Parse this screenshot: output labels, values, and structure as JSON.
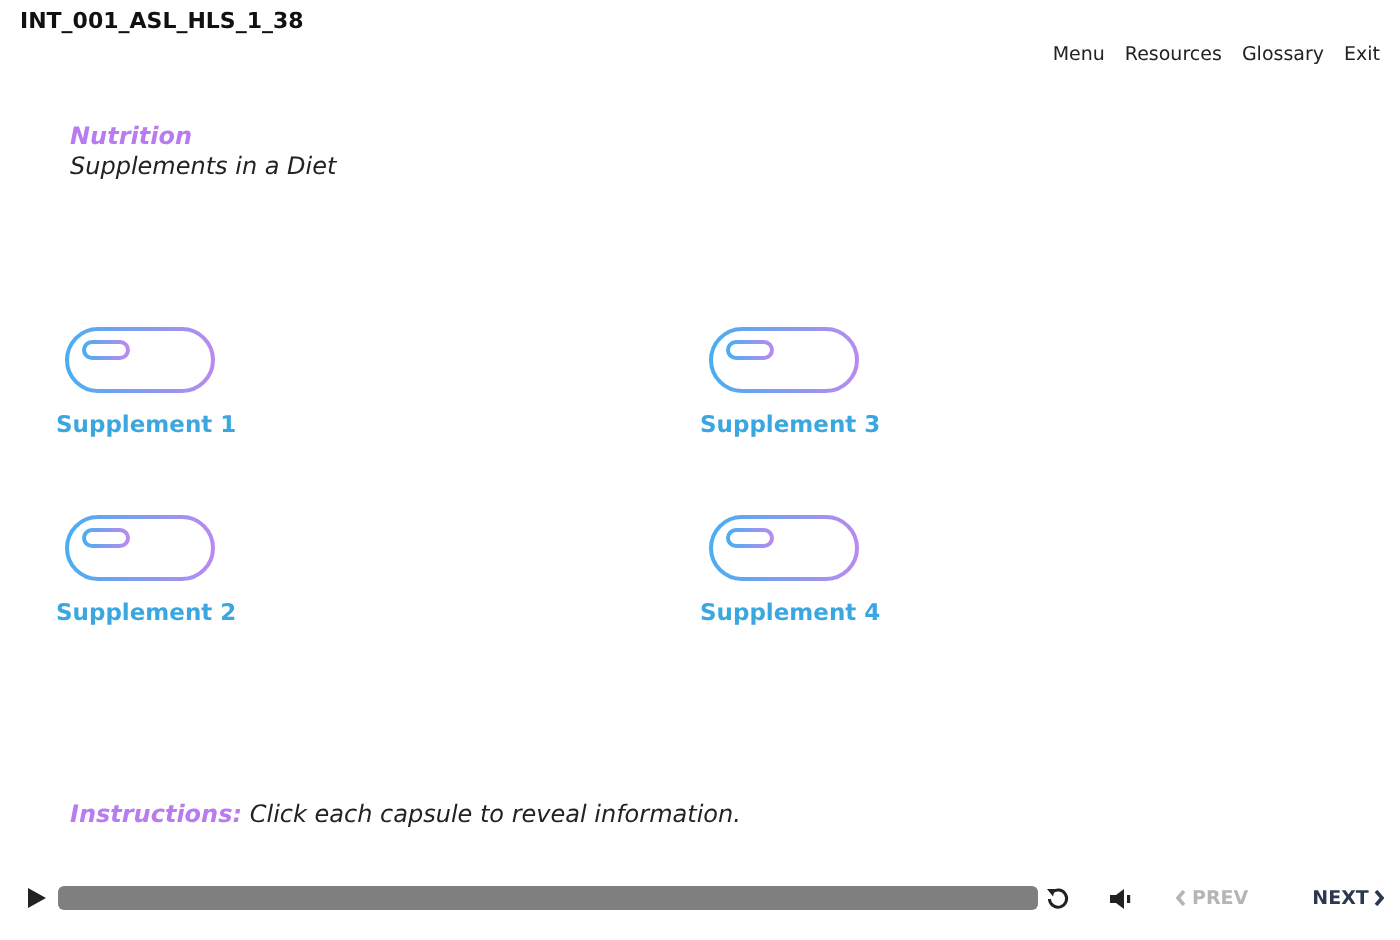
{
  "course_id": "INT_001_ASL_HLS_1_38",
  "top_menu": [
    "Menu",
    "Resources",
    "Glossary",
    "Exit"
  ],
  "header": {
    "topic": "Nutrition",
    "title": "Supplements in a Diet"
  },
  "supplements": [
    {
      "label": "Supplement 1"
    },
    {
      "label": "Supplement 3"
    },
    {
      "label": "Supplement 2"
    },
    {
      "label": "Supplement 4"
    }
  ],
  "instructions": "**Instructions:** Click each capsule to reveal information.",
  "player": {
    "nav": [
      {
        "label": "PREV",
        "kind": "prev",
        "disabled": true
      },
      {
        "label": "NEXT",
        "kind": "next",
        "disabled": false
      }
    ]
  }
}
